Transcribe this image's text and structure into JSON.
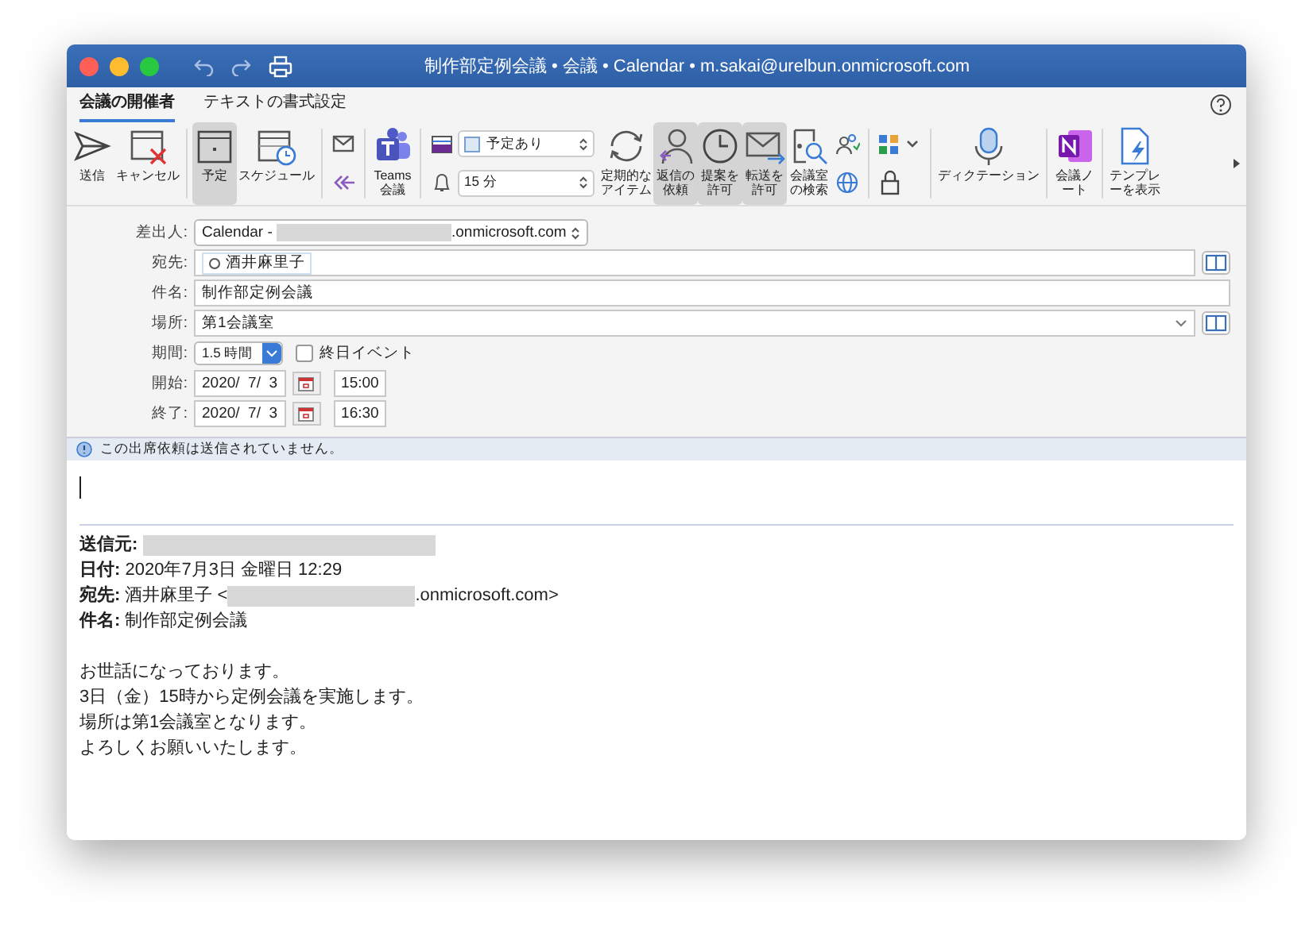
{
  "window": {
    "title": "制作部定例会議 • 会議 • Calendar • m.sakai@urelbun.onmicrosoft.com"
  },
  "tabs": [
    {
      "label": "会議の開催者",
      "selected": true
    },
    {
      "label": "テキストの書式設定",
      "selected": false
    }
  ],
  "ribbon": [
    {
      "kind": "large",
      "label": "送信",
      "on": false
    },
    {
      "kind": "large",
      "label": "キャンセル",
      "on": false
    },
    {
      "kind": "separator"
    },
    {
      "kind": "large",
      "label": "予定",
      "on": true
    },
    {
      "kind": "large",
      "label": "スケジュール",
      "on": false
    },
    {
      "kind": "separator"
    },
    {
      "kind": "stack"
    },
    {
      "kind": "separator"
    },
    {
      "kind": "large",
      "label": "Teams\n会議",
      "on": false
    },
    {
      "kind": "separator"
    },
    {
      "kind": "dropdowns",
      "show_as": "予定あり",
      "reminder": "15 分"
    },
    {
      "kind": "large",
      "label": "定期的なアイテム",
      "on": false,
      "wrap": true
    },
    {
      "kind": "large",
      "label": "返信の依頼",
      "on": true,
      "wrap": true
    },
    {
      "kind": "large",
      "label": "提案を許可",
      "on": true,
      "wrap": true
    },
    {
      "kind": "large",
      "label": "転送を許可",
      "on": true,
      "wrap": true
    },
    {
      "kind": "large",
      "label": "会議室の検索",
      "on": false,
      "wrap": true
    },
    {
      "kind": "stack"
    },
    {
      "kind": "separator"
    },
    {
      "kind": "stack"
    },
    {
      "kind": "separator"
    },
    {
      "kind": "large",
      "label": "ディクテーション",
      "on": false
    },
    {
      "kind": "separator"
    },
    {
      "kind": "large",
      "label": "会議ノート",
      "on": false,
      "wrap": true
    },
    {
      "kind": "separator"
    },
    {
      "kind": "large",
      "label": "テンプレーを表示",
      "on": false,
      "wrap": true
    },
    {
      "kind": "more"
    }
  ],
  "form": {
    "from_label": "差出人:",
    "from_prefix": "Calendar - ",
    "from_suffix": ".onmicrosoft.com",
    "to_label": "宛先:",
    "to_recipient": "酒井麻里子",
    "subject_label": "件名:",
    "subject": "制作部定例会議",
    "location_label": "場所:",
    "location": "第1会議室",
    "duration_label": "期間:",
    "duration": "1.5 時間",
    "all_day_label": "終日イベント",
    "all_day": false,
    "start_label": "開始:",
    "start_date": "2020/  7/  3",
    "start_time": "15:00",
    "end_label": "終了:",
    "end_date": "2020/  7/  3",
    "end_time": "16:30"
  },
  "info_bar": "この出席依頼は送信されていません。",
  "body": {
    "headers": [
      {
        "text": "**送信元:** ",
        "redacted": true
      },
      {
        "text": "**日付:** 2020年7月3日 金曜日 12:29",
        "redacted": false
      },
      {
        "text": "**宛先:** 酒井麻里子 <",
        "redacted": true,
        "after": ".onmicrosoft.com>"
      },
      {
        "text": "**件名:** 制作部定例会議",
        "redacted": false
      }
    ],
    "lines": [
      "お世話になっております。",
      "3日（金）15時から定例会議を実施します。",
      "場所は第1会議室となります。",
      "よろしくお願いいたします。"
    ]
  }
}
